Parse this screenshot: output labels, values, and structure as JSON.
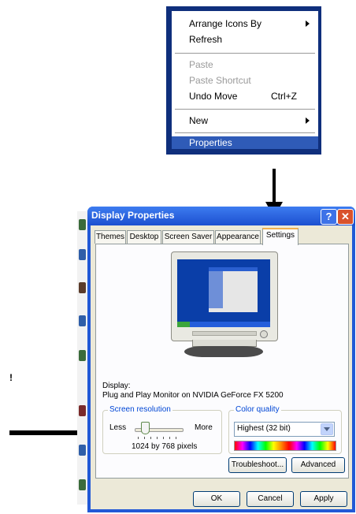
{
  "context_menu": {
    "items": [
      {
        "label": "Arrange Icons By",
        "submenu": true
      },
      {
        "label": "Refresh"
      },
      {
        "label": "Paste",
        "disabled": true
      },
      {
        "label": "Paste Shortcut",
        "disabled": true
      },
      {
        "label": "Undo Move",
        "shortcut": "Ctrl+Z"
      },
      {
        "label": "New",
        "submenu": true
      },
      {
        "label": "Properties",
        "selected": true
      }
    ]
  },
  "left_glyph": "ǃ",
  "window": {
    "title": "Display Properties",
    "help_label": "?",
    "close_label": "✕",
    "tabs": [
      "Themes",
      "Desktop",
      "Screen Saver",
      "Appearance",
      "Settings"
    ],
    "active_tab": "Settings",
    "display_label": "Display:",
    "display_value": "Plug and Play Monitor on NVIDIA GeForce FX 5200",
    "resolution": {
      "title": "Screen resolution",
      "less": "Less",
      "more": "More",
      "value": "1024 by 768 pixels"
    },
    "color_quality": {
      "title": "Color quality",
      "value": "Highest (32 bit)"
    },
    "buttons": {
      "troubleshoot": "Troubleshoot...",
      "advanced": "Advanced",
      "ok": "OK",
      "cancel": "Cancel",
      "apply": "Apply"
    }
  },
  "colors": {
    "title_bar": "#2259d6",
    "menu_highlight": "#2f5bb7",
    "group_title": "#0046d5",
    "dialog_face": "#ece9d8"
  }
}
